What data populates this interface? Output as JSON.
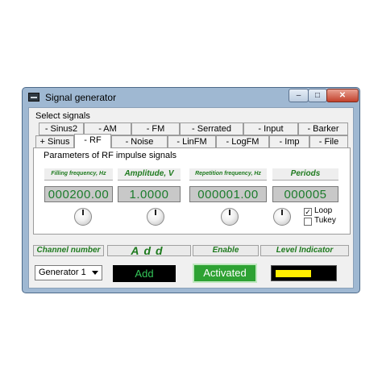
{
  "window": {
    "title": "Signal generator",
    "min": "–",
    "max": "□",
    "close": "✕"
  },
  "select_label": "Select signals",
  "tabs_row1": [
    "- Sinus2",
    "- AM",
    "- FM",
    "- Serrated",
    "- Input",
    "- Barker"
  ],
  "tabs_row2": [
    "+ Sinus",
    "- RF",
    "- Noise",
    "- LinFM",
    "- LogFM",
    "- Imp",
    "- File"
  ],
  "active_tab": "- RF",
  "panel": {
    "label": "Parameters of  RF impulse signals",
    "params": [
      {
        "header": "Filling frequency, Hz",
        "value": "000200.00"
      },
      {
        "header": "Amplitude, V",
        "value": "1.0000"
      },
      {
        "header": "Repetition frequency, Hz",
        "value": "000001.00"
      },
      {
        "header": "Periods",
        "value": "000005"
      }
    ],
    "loop": {
      "label": "Loop",
      "checked": true,
      "mark": "✓"
    },
    "tukey": {
      "label": "Tukey",
      "checked": false,
      "mark": ""
    }
  },
  "bottom": {
    "headers": [
      "Channel number",
      "Add",
      "Enable",
      "Level Indicator"
    ],
    "channel": "Generator 1",
    "add_label": "Add",
    "enable_label": "Activated",
    "level_fraction": 0.55
  },
  "colors": {
    "accent_green": "#1e7a1e",
    "lcd_green": "#1c7c2c",
    "active_green": "#2ea233",
    "level_yellow": "#ffee00"
  }
}
